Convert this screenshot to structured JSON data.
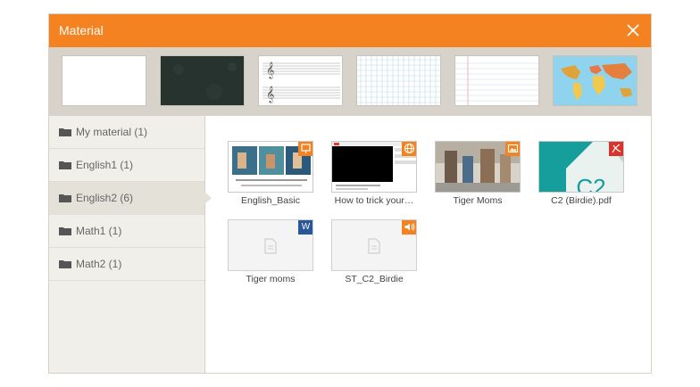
{
  "dialog": {
    "title": "Material"
  },
  "backgrounds": [
    {
      "name": "blank"
    },
    {
      "name": "chalkboard"
    },
    {
      "name": "music-staff"
    },
    {
      "name": "grid-paper"
    },
    {
      "name": "lined-paper"
    },
    {
      "name": "world-map"
    }
  ],
  "sidebar": {
    "items": [
      {
        "label": "My material (1)",
        "active": false
      },
      {
        "label": "English1 (1)",
        "active": false
      },
      {
        "label": "English2 (6)",
        "active": true
      },
      {
        "label": "Math1 (1)",
        "active": false
      },
      {
        "label": "Math2 (1)",
        "active": false
      }
    ]
  },
  "files": [
    {
      "label": "English_Basic",
      "type": "presentation",
      "badge_color": "#f58220",
      "badge_icon": "presentation-icon"
    },
    {
      "label": "How to trick your…",
      "type": "web",
      "badge_color": "#f58220",
      "badge_icon": "globe-icon"
    },
    {
      "label": "Tiger Moms",
      "type": "image",
      "badge_color": "#f58220",
      "badge_icon": "image-icon"
    },
    {
      "label": "C2 (Birdie).pdf",
      "type": "pdf",
      "badge_color": "#d9342b",
      "badge_icon": "pdf-icon",
      "thumb_text": "C2"
    },
    {
      "label": "Tiger moms",
      "type": "word",
      "badge_color": "#2a579a",
      "badge_icon": "word-icon",
      "badge_text": "W"
    },
    {
      "label": "ST_C2_Birdie",
      "type": "audio",
      "badge_color": "#f58220",
      "badge_icon": "speaker-icon"
    }
  ],
  "colors": {
    "accent": "#f58220",
    "pdf": "#d9342b",
    "word": "#2a579a"
  }
}
